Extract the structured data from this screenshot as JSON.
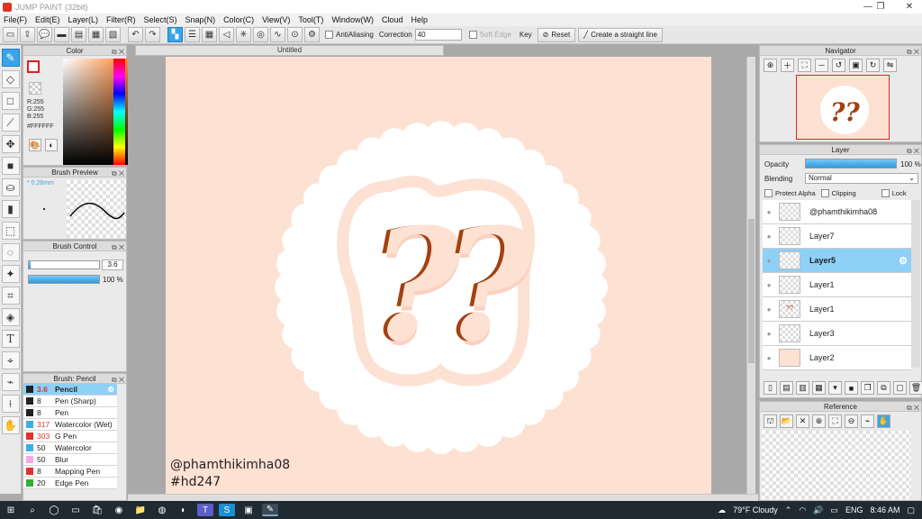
{
  "window": {
    "title": "JUMP PAINT (32bit)",
    "min": "—",
    "max": "❐",
    "close": "✕"
  },
  "menu": [
    "File(F)",
    "Edit(E)",
    "Layer(L)",
    "Filter(R)",
    "Select(S)",
    "Snap(N)",
    "Color(C)",
    "View(V)",
    "Tool(T)",
    "Window(W)",
    "Cloud",
    "Help"
  ],
  "toolbar": {
    "antialiasing": "AntiAliasing",
    "correction_label": "Correction",
    "correction_value": "40",
    "soft_edge": "Soft Edge",
    "key": "Key",
    "reset": "Reset",
    "straight_line": "Create a straight line"
  },
  "color_panel": {
    "title": "Color",
    "r": "R:255",
    "g": "G:255",
    "b": "B:255",
    "hex": "#FFFFFF",
    "accent": "#3ba4e8"
  },
  "brush_preview": {
    "title": "Brush Preview",
    "size": "0.26mm"
  },
  "brush_control": {
    "title": "Brush Control",
    "size": "3.6",
    "opacity": "100 %",
    "opacity_level": 100
  },
  "brush_list": {
    "title": "Brush: Pencil",
    "items": [
      {
        "size": "3.6",
        "name": "Pencil",
        "color": "#222222"
      },
      {
        "size": "8",
        "name": "Pen (Sharp)",
        "color": "#222222"
      },
      {
        "size": "8",
        "name": "Pen",
        "color": "#222222"
      },
      {
        "size": "317",
        "name": "Watercolor (Wet)",
        "color": "#3ab0e8"
      },
      {
        "size": "303",
        "name": "G Pen",
        "color": "#e03030"
      },
      {
        "size": "50",
        "name": "Watercolor",
        "color": "#3ab0e8"
      },
      {
        "size": "50",
        "name": "Blur",
        "color": "#f7a6e6"
      },
      {
        "size": "8",
        "name": "Mapping Pen",
        "color": "#e03030"
      },
      {
        "size": "20",
        "name": "Edge Pen",
        "color": "#30b030"
      }
    ]
  },
  "document": {
    "tab": "Untitled",
    "watermark_1": "@phamthikimha08",
    "watermark_2": "#hd247",
    "bg_color": "#fde1d2",
    "accent_brown": "#a2410f"
  },
  "navigator": {
    "title": "Navigator"
  },
  "layer_panel": {
    "title": "Layer",
    "opacity_label": "Opacity",
    "opacity_value": "100 %",
    "blending_label": "Blending",
    "blending_value": "Normal",
    "protect_alpha": "Protect Alpha",
    "clipping": "Clipping",
    "lock": "Lock",
    "layers": [
      {
        "name": "@phamthikimha08"
      },
      {
        "name": "Layer7"
      },
      {
        "name": "Layer5"
      },
      {
        "name": "Layer1"
      },
      {
        "name": "Layer1",
        "thumb_text": "??"
      },
      {
        "name": "Layer3"
      },
      {
        "name": "Layer2"
      }
    ]
  },
  "reference": {
    "title": "Reference"
  },
  "taskbar": {
    "weather": "79°F  Cloudy",
    "lang": "ENG",
    "time": "8:46 AM"
  }
}
